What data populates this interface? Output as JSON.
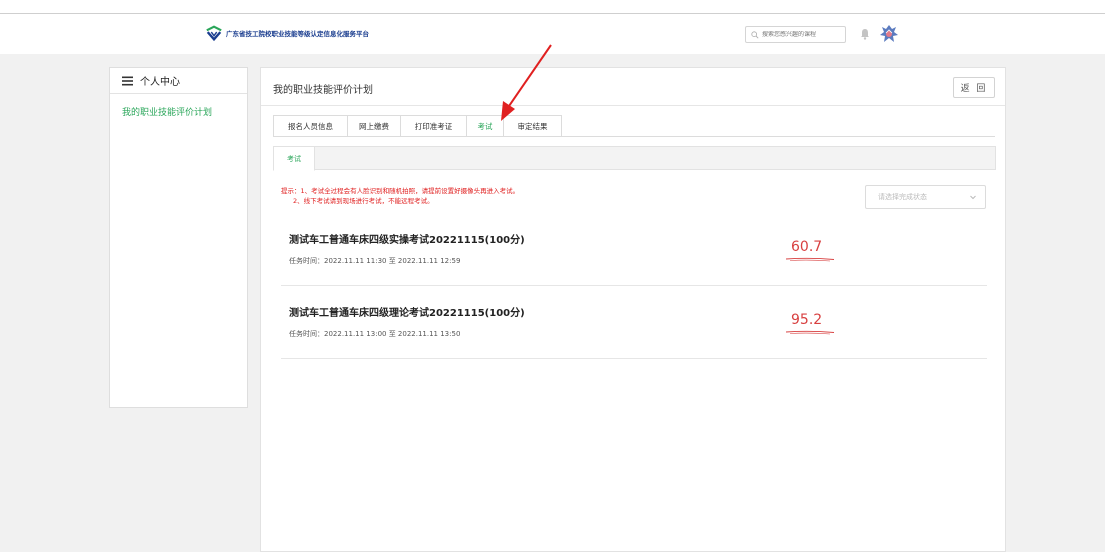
{
  "header": {
    "logo_text": "广东省技工院校职业技能等级认定信息化服务平台",
    "search_placeholder": "搜索您感兴趣的课程",
    "icons": [
      "search-icon",
      "bell-icon",
      "avatar"
    ]
  },
  "sidebar": {
    "title": "个人中心",
    "items": [
      {
        "label": "我的职业技能评价计划"
      }
    ]
  },
  "main": {
    "title": "我的职业技能评价计划",
    "back_label": "返 回",
    "tabs": [
      {
        "label": "报名人员信息"
      },
      {
        "label": "网上缴费"
      },
      {
        "label": "打印准考证"
      },
      {
        "label": "考试",
        "active": true
      },
      {
        "label": "审定结果"
      }
    ],
    "sub_tab": "考试",
    "notice_line1": "提示：1、考试全过程会有人脸识别和随机拍照，请提前设置好摄像头再进入考试。",
    "notice_line2": "2、线下考试请到现场进行考试，不能远程考试。",
    "status_placeholder": "请选择完成状态",
    "exams": [
      {
        "name": "测试车工普通车床四级实操考试20221115(100分)",
        "time": "任务时间：2022.11.11 11:30 至 2022.11.11 12:59",
        "score": "60.7"
      },
      {
        "name": "测试车工普通车床四级理论考试20221115(100分)",
        "time": "任务时间：2022.11.11 13:00 至 2022.11.11 13:50",
        "score": "95.2"
      }
    ]
  },
  "colors": {
    "accent_green": "#2aa65a",
    "notice_red": "#e02020",
    "score_red": "#d84040",
    "brand_blue": "#1a3d8f"
  }
}
